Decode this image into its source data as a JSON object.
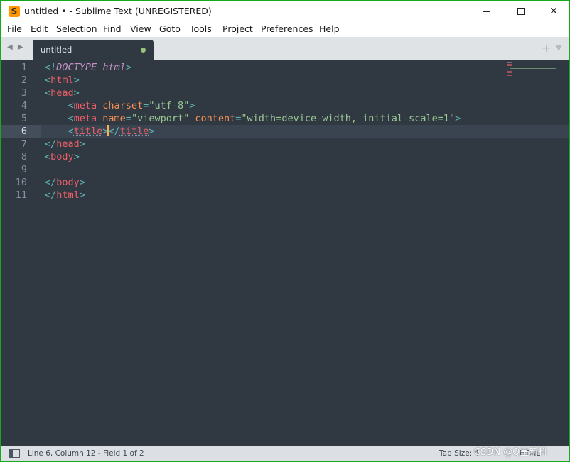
{
  "window": {
    "title": "untitled • - Sublime Text (UNREGISTERED)",
    "icon_glyph": "S",
    "controls": {
      "minimize": "minimize-icon",
      "maximize": "maximize-icon",
      "close": "✕"
    }
  },
  "menu": [
    {
      "mnemonic": "F",
      "rest": "ile"
    },
    {
      "mnemonic": "E",
      "rest": "dit"
    },
    {
      "mnemonic": "S",
      "rest": "election"
    },
    {
      "mnemonic": "F",
      "rest": "ind"
    },
    {
      "mnemonic": "V",
      "rest": "iew"
    },
    {
      "mnemonic": "G",
      "rest": "oto"
    },
    {
      "mnemonic": "T",
      "rest": "ools"
    },
    {
      "mnemonic": "P",
      "rest": "roject"
    },
    {
      "mnemonic": "",
      "rest": "Preferences"
    },
    {
      "mnemonic": "H",
      "rest": "elp"
    }
  ],
  "tabs": {
    "nav_arrows": "◀ ▶",
    "active": {
      "label": "untitled",
      "dirty": true
    },
    "new_tab": "+",
    "tab_menu": "▼"
  },
  "editor": {
    "line_numbers": [
      "1",
      "2",
      "3",
      "4",
      "5",
      "6",
      "7",
      "8",
      "9",
      "10",
      "11"
    ],
    "current_line": "6",
    "lines": [
      [
        {
          "t": "<!",
          "c": "punc"
        },
        {
          "t": "DOCTYPE",
          "c": "doct"
        },
        {
          "t": " ",
          "c": ""
        },
        {
          "t": "html",
          "c": "doct"
        },
        {
          "t": ">",
          "c": "punc"
        }
      ],
      [
        {
          "t": "<",
          "c": "punc"
        },
        {
          "t": "html",
          "c": "tag"
        },
        {
          "t": ">",
          "c": "punc"
        }
      ],
      [
        {
          "t": "<",
          "c": "punc"
        },
        {
          "t": "head",
          "c": "tag"
        },
        {
          "t": ">",
          "c": "punc"
        }
      ],
      [
        {
          "t": "    <",
          "c": "punc"
        },
        {
          "t": "meta",
          "c": "tag"
        },
        {
          "t": " ",
          "c": ""
        },
        {
          "t": "charset",
          "c": "attr"
        },
        {
          "t": "=",
          "c": "punc"
        },
        {
          "t": "\"utf-8\"",
          "c": "str"
        },
        {
          "t": ">",
          "c": "punc"
        }
      ],
      [
        {
          "t": "    <",
          "c": "punc"
        },
        {
          "t": "meta",
          "c": "tag"
        },
        {
          "t": " ",
          "c": ""
        },
        {
          "t": "name",
          "c": "attr"
        },
        {
          "t": "=",
          "c": "punc"
        },
        {
          "t": "\"viewport\"",
          "c": "str"
        },
        {
          "t": " ",
          "c": ""
        },
        {
          "t": "content",
          "c": "attr"
        },
        {
          "t": "=",
          "c": "punc"
        },
        {
          "t": "\"width=device-width, initial-scale=1\"",
          "c": "str"
        },
        {
          "t": ">",
          "c": "punc"
        }
      ],
      [
        {
          "t": "    <",
          "c": "punc"
        },
        {
          "t": "title",
          "c": "wtag"
        },
        {
          "t": ">",
          "c": "punc"
        },
        {
          "t": "|",
          "c": "cursor"
        },
        {
          "t": "</",
          "c": "punc"
        },
        {
          "t": "title",
          "c": "wtag"
        },
        {
          "t": ">",
          "c": "punc"
        }
      ],
      [
        {
          "t": "</",
          "c": "punc"
        },
        {
          "t": "head",
          "c": "tag"
        },
        {
          "t": ">",
          "c": "punc"
        }
      ],
      [
        {
          "t": "<",
          "c": "punc"
        },
        {
          "t": "body",
          "c": "tag"
        },
        {
          "t": ">",
          "c": "punc"
        }
      ],
      [],
      [
        {
          "t": "</",
          "c": "punc"
        },
        {
          "t": "body",
          "c": "tag"
        },
        {
          "t": ">",
          "c": "punc"
        }
      ],
      [
        {
          "t": "</",
          "c": "punc"
        },
        {
          "t": "html",
          "c": "tag"
        },
        {
          "t": ">",
          "c": "punc"
        }
      ]
    ]
  },
  "status": {
    "position": "Line 6, Column 12 - Field 1 of 2",
    "tab_size": "Tab Size: 4",
    "syntax": "HTML"
  },
  "watermark": "CSDN @Q呈新科",
  "colors": {
    "editor_bg": "#303841",
    "tag": "#ec5f67",
    "attribute": "#f99157",
    "string": "#99c794",
    "punctuation": "#5fb3b3",
    "doctype": "#c594c5",
    "cursor": "#f9ae58",
    "dirty_dot": "#97c17f",
    "window_border": "#17a91c"
  }
}
